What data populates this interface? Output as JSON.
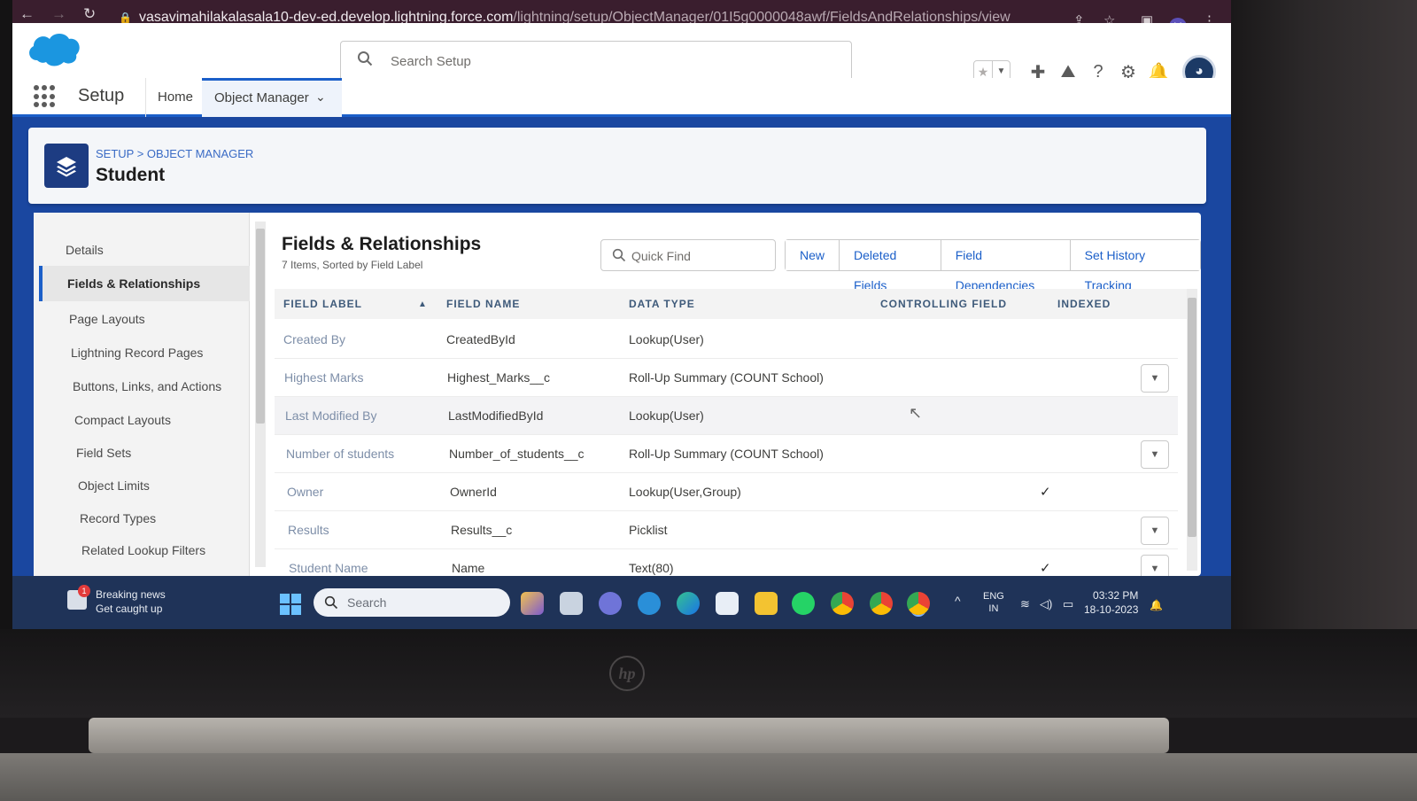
{
  "browser": {
    "url_host": "vasavimahilakalasala10-dev-ed.develop.lightning.force.com",
    "url_path": "/lightning/setup/ObjectManager/01I5g0000048awf/FieldsAndRelationships/view",
    "profile_initial": "V"
  },
  "header": {
    "search_placeholder": "Search Setup"
  },
  "nav": {
    "app_name": "Setup",
    "home_label": "Home",
    "object_manager_label": "Object Manager"
  },
  "page_header": {
    "breadcrumb": "SETUP > OBJECT MANAGER",
    "object_name": "Student"
  },
  "sidebar": {
    "items": [
      {
        "label": "Details"
      },
      {
        "label": "Fields & Relationships"
      },
      {
        "label": "Page Layouts"
      },
      {
        "label": "Lightning Record Pages"
      },
      {
        "label": "Buttons, Links, and Actions"
      },
      {
        "label": "Compact Layouts"
      },
      {
        "label": "Field Sets"
      },
      {
        "label": "Object Limits"
      },
      {
        "label": "Record Types"
      },
      {
        "label": "Related Lookup Filters"
      }
    ],
    "active_index": 1
  },
  "main": {
    "title": "Fields & Relationships",
    "subtitle": "7 Items, Sorted by Field Label",
    "quick_find_placeholder": "Quick Find",
    "buttons": [
      "New",
      "Deleted Fields",
      "Field Dependencies",
      "Set History Tracking"
    ]
  },
  "table": {
    "columns": [
      "FIELD LABEL",
      "FIELD NAME",
      "DATA TYPE",
      "CONTROLLING FIELD",
      "INDEXED"
    ],
    "rows": [
      {
        "label": "Created By",
        "name": "CreatedById",
        "type": "Lookup(User)",
        "controlling": "",
        "indexed": false,
        "menu": false
      },
      {
        "label": "Highest Marks",
        "name": "Highest_Marks__c",
        "type": "Roll-Up Summary (COUNT School)",
        "controlling": "",
        "indexed": false,
        "menu": true
      },
      {
        "label": "Last Modified By",
        "name": "LastModifiedById",
        "type": "Lookup(User)",
        "controlling": "",
        "indexed": false,
        "menu": false
      },
      {
        "label": "Number of students",
        "name": "Number_of_students__c",
        "type": "Roll-Up Summary (COUNT School)",
        "controlling": "",
        "indexed": false,
        "menu": true
      },
      {
        "label": "Owner",
        "name": "OwnerId",
        "type": "Lookup(User,Group)",
        "controlling": "",
        "indexed": true,
        "menu": false
      },
      {
        "label": "Results",
        "name": "Results__c",
        "type": "Picklist",
        "controlling": "",
        "indexed": false,
        "menu": true
      },
      {
        "label": "Student Name",
        "name": "Name",
        "type": "Text(80)",
        "controlling": "",
        "indexed": true,
        "menu": true
      }
    ],
    "check_glyph": "✓",
    "menu_glyph": "▼"
  },
  "taskbar": {
    "news_title": "Breaking news",
    "news_sub": "Get caught up",
    "news_badge": "1",
    "search_placeholder": "Search",
    "lang_1": "ENG",
    "lang_2": "IN",
    "time": "03:32 PM",
    "date": "18-10-2023"
  },
  "device": {
    "brand_logo": "hp"
  },
  "colors": {
    "brand_blue": "#1b5fc9",
    "header_band": "#1a47a0",
    "taskbar": "#1f3358",
    "browser_bar": "#3a1e2e"
  }
}
